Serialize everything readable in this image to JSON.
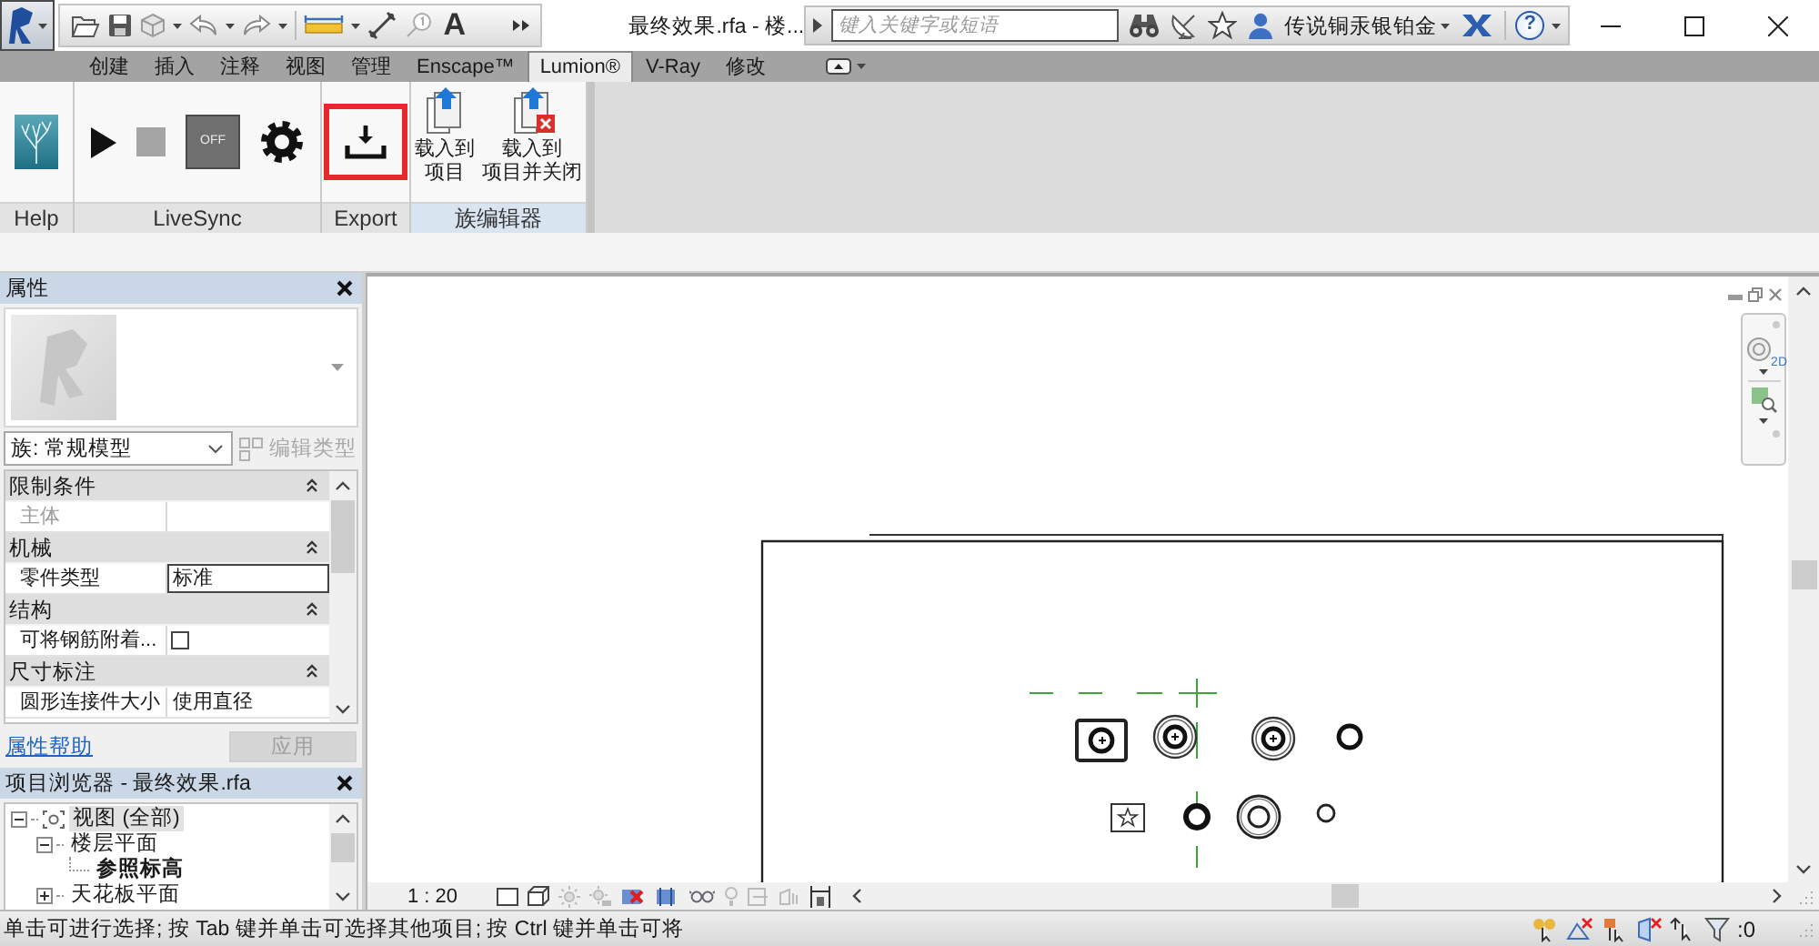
{
  "title_bar": {
    "title": "最终效果.rfa - 楼...",
    "search": {
      "placeholder": "键入关键字或短语"
    },
    "user_name": "传说铜汞银铂金",
    "help_glyph": "?"
  },
  "quick_access": {
    "text_tool": "A"
  },
  "ribbon_tabs": [
    {
      "label": "创建",
      "selected": false
    },
    {
      "label": "插入",
      "selected": false
    },
    {
      "label": "注释",
      "selected": false
    },
    {
      "label": "视图",
      "selected": false
    },
    {
      "label": "管理",
      "selected": false
    },
    {
      "label": "Enscape™",
      "selected": false
    },
    {
      "label": "Lumion®",
      "selected": true
    },
    {
      "label": "V-Ray",
      "selected": false
    },
    {
      "label": "修改",
      "selected": false
    }
  ],
  "ribbon_panels": [
    {
      "label": "Help",
      "contextual": false,
      "tools": [
        {
          "kind": "logo"
        }
      ]
    },
    {
      "label": "LiveSync",
      "contextual": false,
      "tools": [
        {
          "kind": "play"
        },
        {
          "kind": "stop"
        },
        {
          "kind": "toggle",
          "label": "OFF"
        },
        {
          "kind": "settings"
        }
      ]
    },
    {
      "label": "Export",
      "contextual": false,
      "tools": [
        {
          "kind": "export",
          "highlighted": true
        }
      ]
    },
    {
      "label": "族编辑器",
      "contextual": true,
      "tools": [
        {
          "kind": "load",
          "lines": [
            "载入到",
            "项目"
          ]
        },
        {
          "kind": "load_close",
          "lines": [
            "载入到",
            "项目并关闭"
          ]
        }
      ]
    }
  ],
  "properties": {
    "title": "属性",
    "type_selector": "族: 常规模型",
    "edit_type": {
      "label": "编辑类型",
      "disabled": true
    },
    "groups": [
      {
        "name": "限制条件",
        "rows": [
          {
            "kind": "text",
            "label": "主体",
            "disabled": true,
            "focused": false
          }
        ]
      },
      {
        "name": "机械",
        "rows": [
          {
            "kind": "text",
            "label": "零件类型",
            "value": "标准",
            "disabled": false,
            "focused": true
          }
        ]
      },
      {
        "name": "结构",
        "rows": [
          {
            "kind": "checkbox",
            "label": "可将钢筋附着...",
            "checked": false,
            "disabled": false
          }
        ]
      },
      {
        "name": "尺寸标注",
        "rows": [
          {
            "kind": "text",
            "label": "圆形连接件大小",
            "value": "使用直径",
            "disabled": false,
            "focused": false
          }
        ]
      }
    ],
    "help_link": "属性帮助",
    "apply": {
      "label": "应用",
      "disabled": true
    }
  },
  "project_browser": {
    "title": "项目浏览器 - 最终效果.rfa",
    "tree": [
      {
        "label": "视图 (全部)",
        "expanded": true,
        "selected": true,
        "current": false,
        "children": [
          {
            "label": "楼层平面",
            "expanded": true,
            "selected": false,
            "current": false,
            "children": [
              {
                "label": "参照标高",
                "selected": false,
                "current": true
              }
            ]
          },
          {
            "label": "天花板平面",
            "expanded": false,
            "selected": false,
            "current": false
          }
        ]
      }
    ]
  },
  "canvas": {
    "nav_badge": "2D"
  },
  "view_bar": {
    "scale": "1 : 20"
  },
  "status_bar": {
    "message": "单击可进行选择; 按 Tab 键并单击可选择其他项目; 按 Ctrl 键并单击可将",
    "filter_count": ":0"
  }
}
